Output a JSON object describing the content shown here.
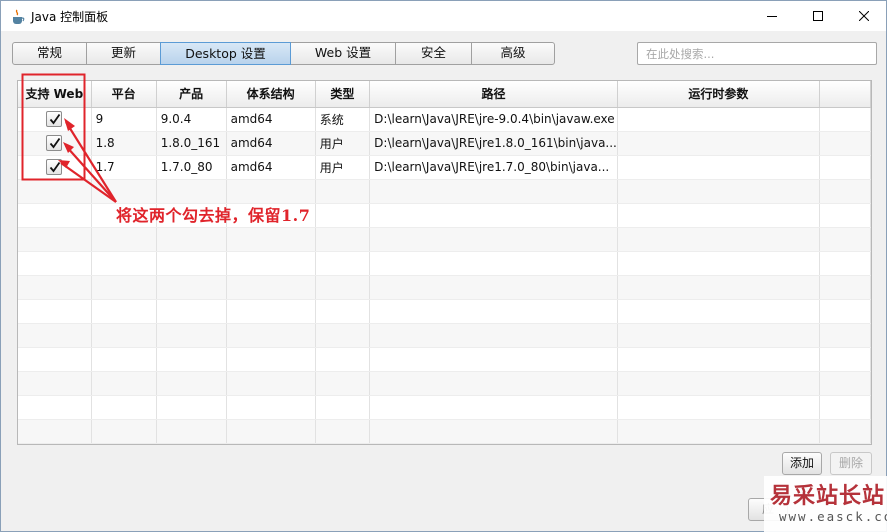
{
  "window": {
    "title": "Java 控制面板",
    "controls": {
      "minimize": "minimize-icon",
      "maximize": "maximize-icon",
      "close": "close-icon"
    }
  },
  "tabs": [
    {
      "label": "常规",
      "active": false
    },
    {
      "label": "更新",
      "active": false
    },
    {
      "label": "Desktop 设置",
      "active": true
    },
    {
      "label": "Web 设置",
      "active": false
    },
    {
      "label": "安全",
      "active": false
    },
    {
      "label": "高级",
      "active": false
    }
  ],
  "search": {
    "placeholder": "在此处搜索..."
  },
  "table": {
    "columns": [
      "支持 Web",
      "平台",
      "产品",
      "体系结构",
      "类型",
      "路径",
      "运行时参数",
      ""
    ],
    "rows": [
      {
        "web": true,
        "platform": "9",
        "product": "9.0.4",
        "arch": "amd64",
        "type": "系统",
        "path": "D:\\learn\\Java\\JRE\\jre-9.0.4\\bin\\javaw.exe",
        "params": ""
      },
      {
        "web": true,
        "platform": "1.8",
        "product": "1.8.0_161",
        "arch": "amd64",
        "type": "用户",
        "path": "D:\\learn\\Java\\JRE\\jre1.8.0_161\\bin\\java...",
        "params": ""
      },
      {
        "web": true,
        "platform": "1.7",
        "product": "1.7.0_80",
        "arch": "amd64",
        "type": "用户",
        "path": "D:\\learn\\Java\\JRE\\jre1.7.0_80\\bin\\java...",
        "params": ""
      }
    ]
  },
  "buttons": {
    "add": "添加",
    "remove": "删除",
    "apply": "应"
  },
  "annotation": {
    "text": "将这两个勾去掉，保留1.7",
    "color": "#e0242b"
  },
  "watermark": {
    "cn": "易采站长站",
    "en": "www.easck.com"
  }
}
